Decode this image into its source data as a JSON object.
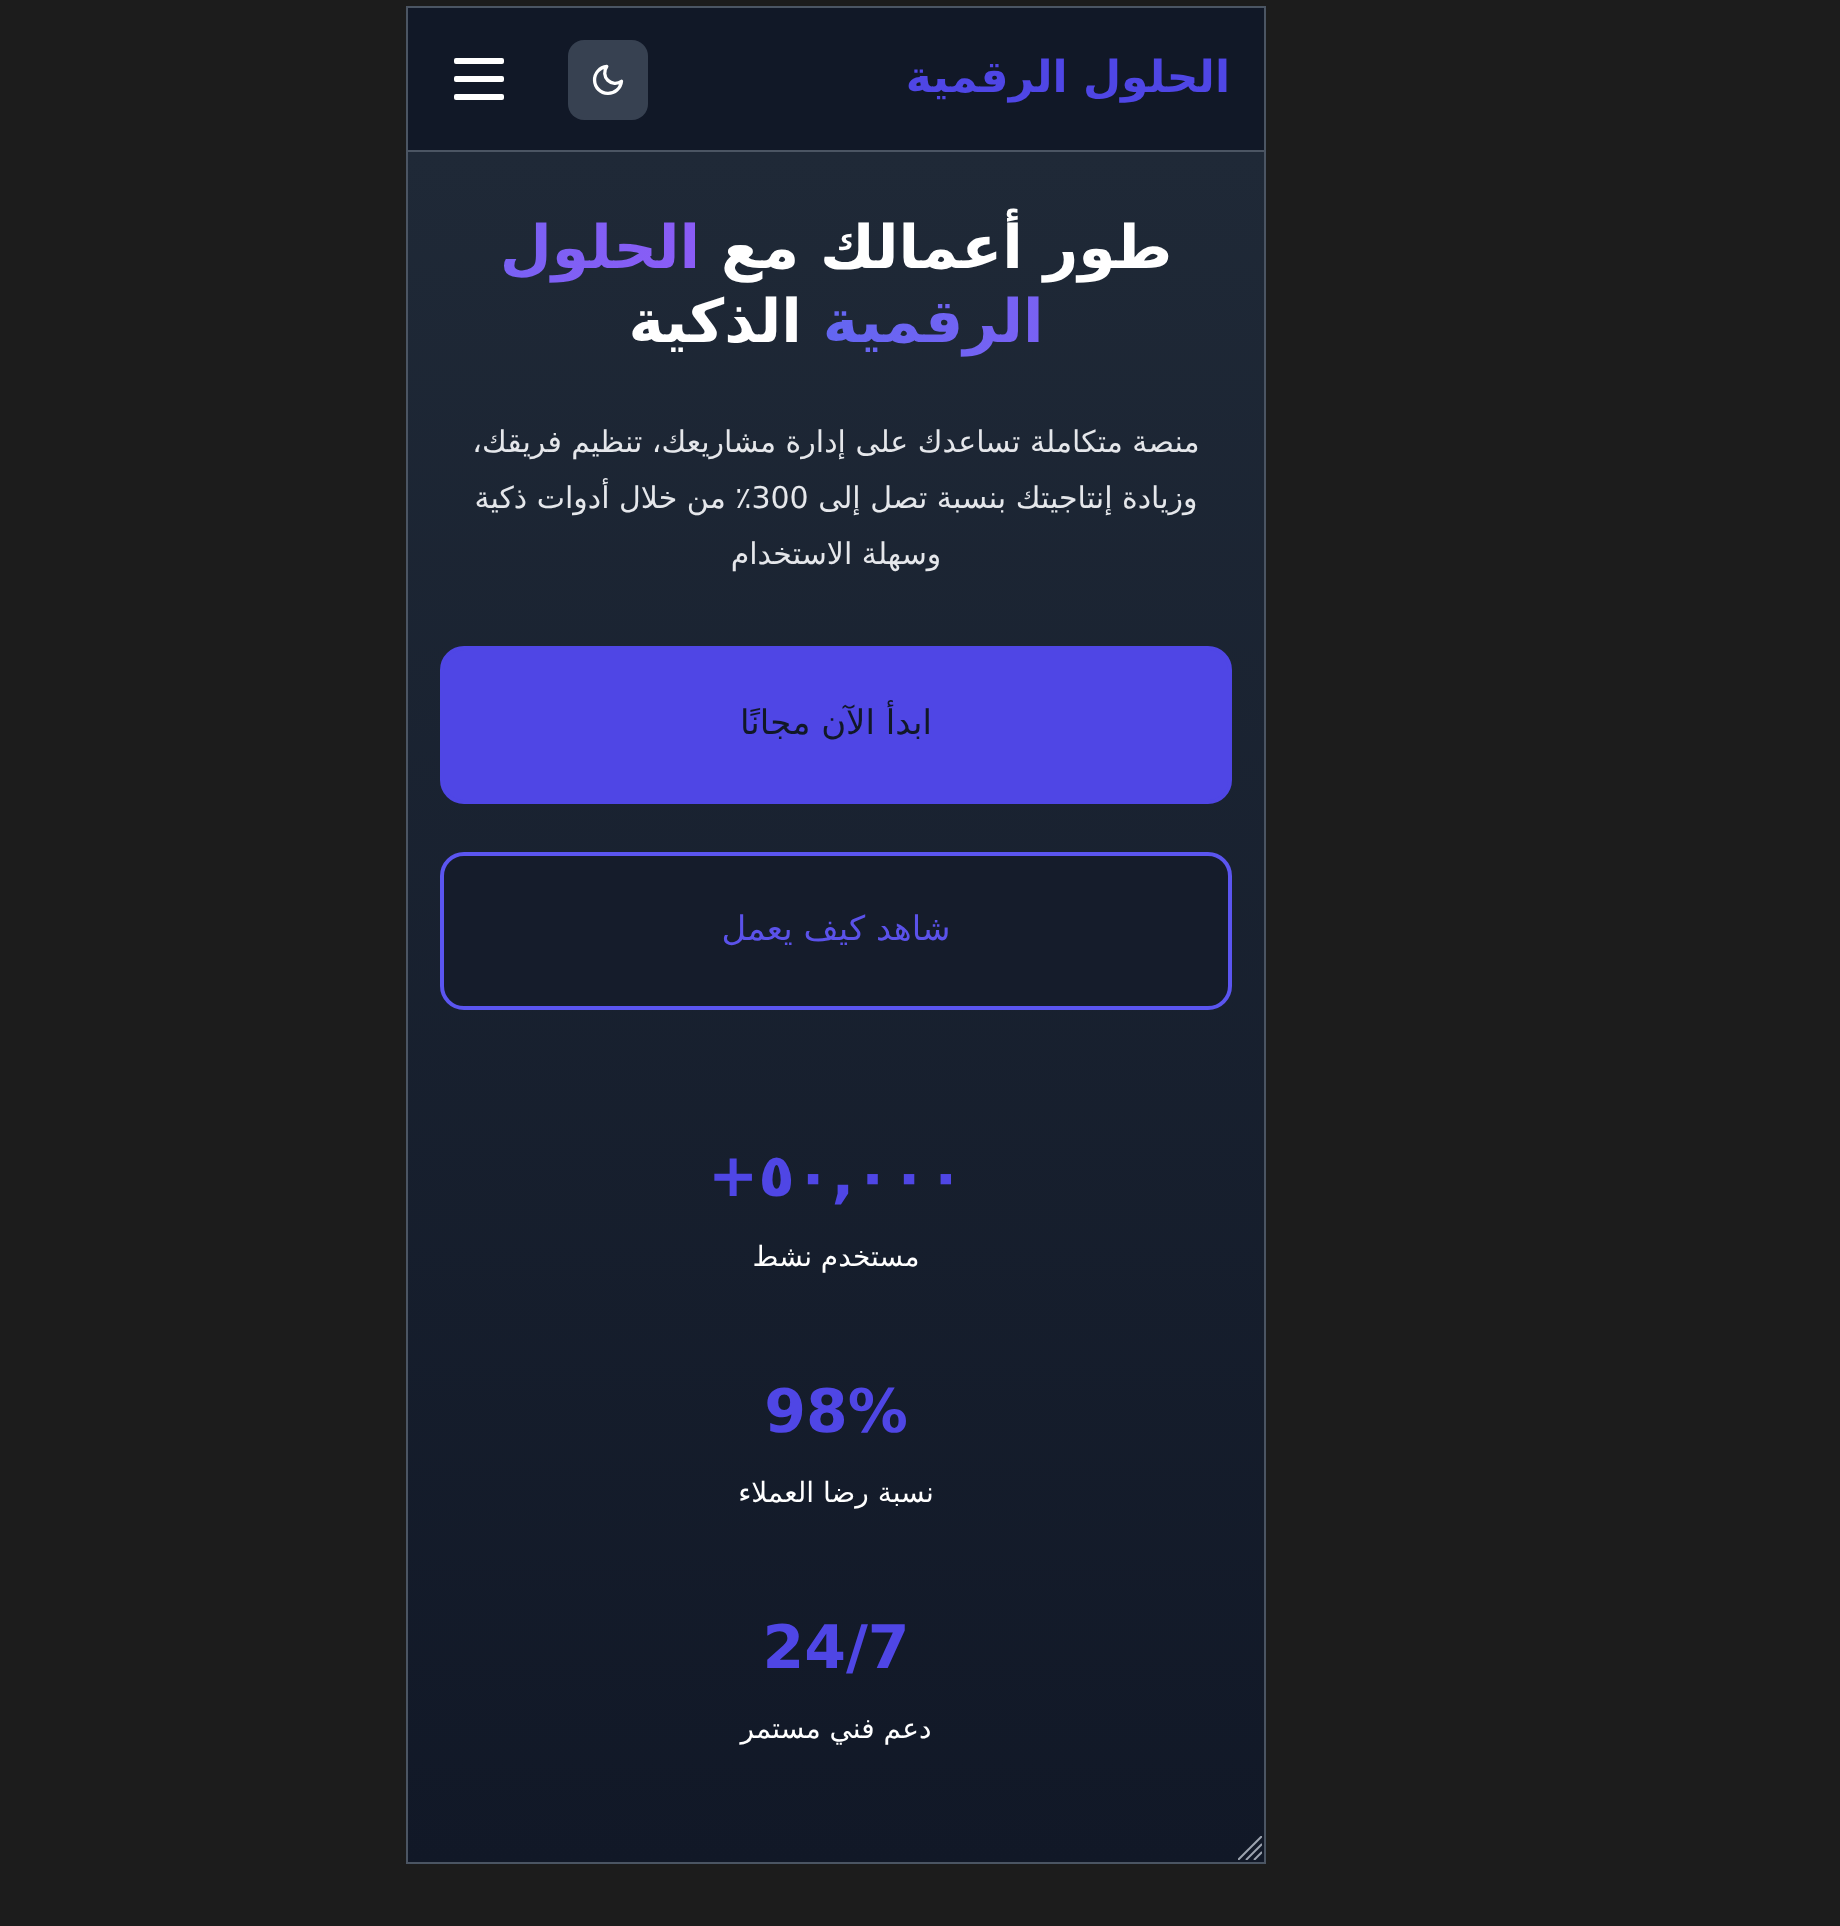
{
  "header": {
    "brand": "الحلول الرقمية"
  },
  "hero": {
    "heading": [
      {
        "text": "طور أعمالك مع",
        "highlight": false
      },
      {
        "text": "الحلول الرقمية",
        "highlight": true
      },
      {
        "text": "الذكية",
        "highlight": false
      }
    ],
    "description": "منصة متكاملة تساعدك على إدارة مشاريعك، تنظيم فريقك، وزيادة إنتاجيتك بنسبة تصل إلى 300٪ من خلال أدوات ذكية وسهلة الاستخدام",
    "buttons": [
      {
        "label": "ابدأ الآن مجانًا",
        "kind": "primary"
      },
      {
        "label": "شاهد كيف يعمل",
        "kind": "outline"
      }
    ]
  },
  "stats": [
    {
      "value": "+٥٠,٠٠٠",
      "label": "مستخدم نشط"
    },
    {
      "value": "98%",
      "label": "نسبة رضا العملاء"
    },
    {
      "value": "24/7",
      "label": "دعم فني مستمر"
    }
  ]
}
